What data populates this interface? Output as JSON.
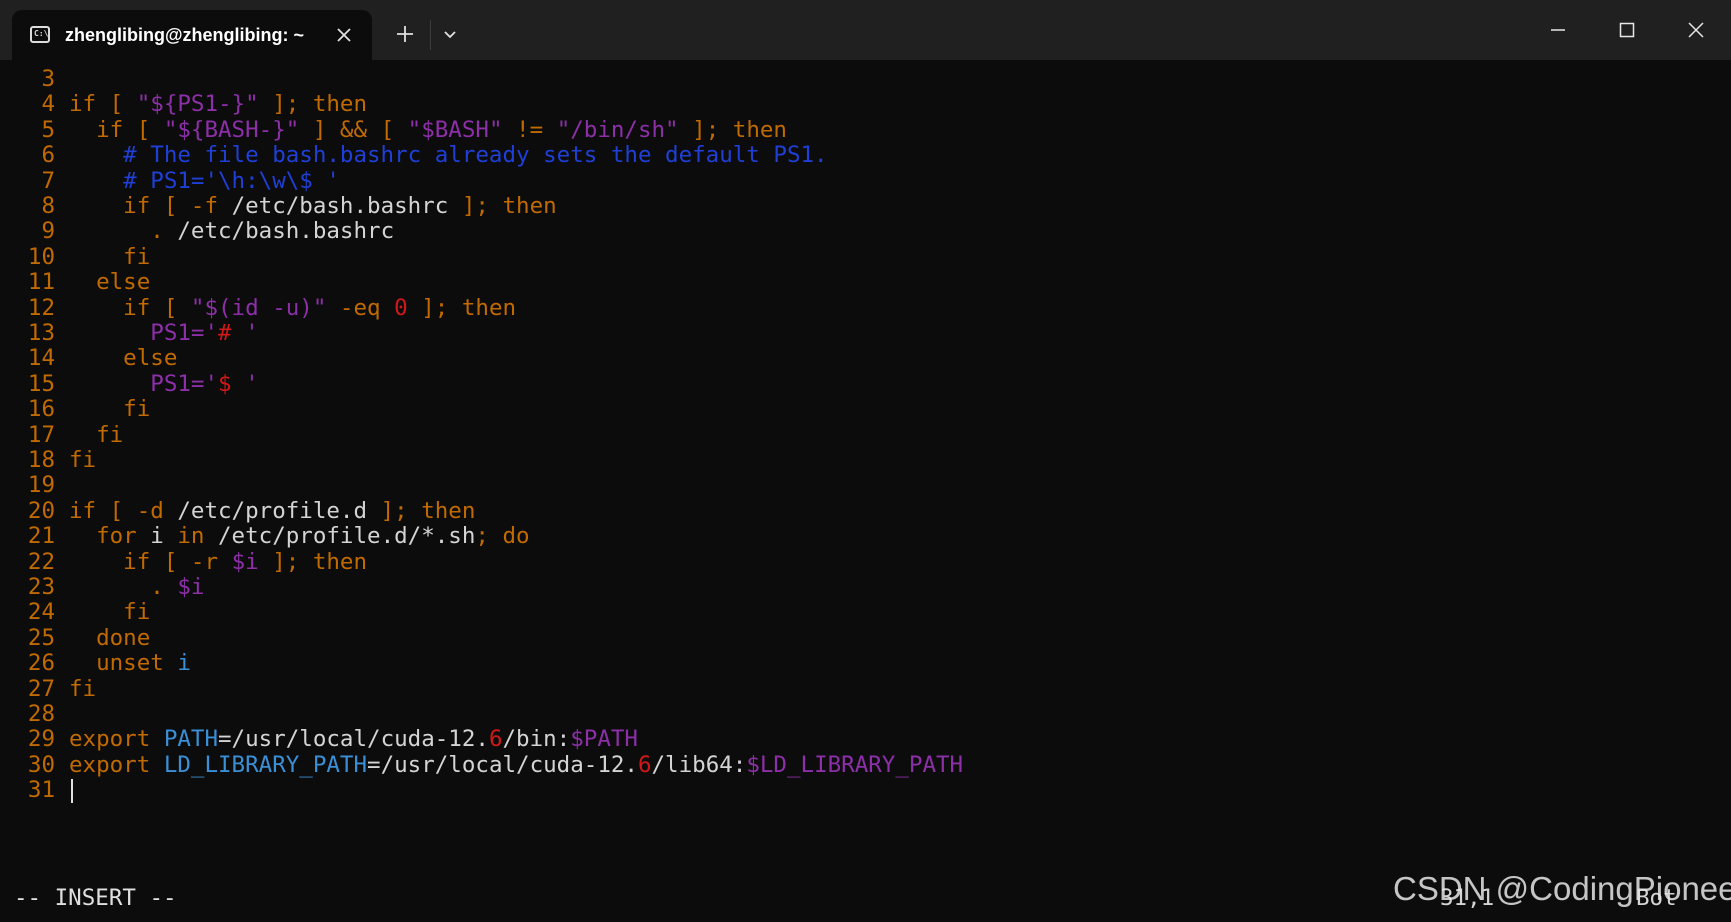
{
  "window": {
    "tab_title": "zhenglibing@zhenglibing: ~",
    "icons": {
      "terminal": "terminal-icon",
      "close_tab": "close-icon",
      "new_tab": "plus-icon",
      "dropdown": "chevron-down-icon",
      "minimize": "minimize-icon",
      "maximize": "maximize-icon",
      "close": "close-icon"
    }
  },
  "editor": {
    "lines": [
      {
        "n": "3",
        "segs": []
      },
      {
        "n": "4",
        "segs": [
          [
            "k",
            "if [ "
          ],
          [
            "str",
            "\"${PS1-}\""
          ],
          [
            "k",
            " ]; then"
          ]
        ]
      },
      {
        "n": "5",
        "segs": [
          [
            "k",
            "  if [ "
          ],
          [
            "str",
            "\"${BASH-}\""
          ],
          [
            "k",
            " ] && [ "
          ],
          [
            "str",
            "\"$BASH\""
          ],
          [
            "k",
            " != "
          ],
          [
            "str",
            "\"/bin/sh\""
          ],
          [
            "k",
            " ]; then"
          ]
        ]
      },
      {
        "n": "6",
        "segs": [
          [
            "cmt",
            "    # The file bash.bashrc already sets the default PS1."
          ]
        ]
      },
      {
        "n": "7",
        "segs": [
          [
            "cmt",
            "    # PS1='\\h:\\w\\$ '"
          ]
        ]
      },
      {
        "n": "8",
        "segs": [
          [
            "k",
            "    if [ -f "
          ],
          [
            "dflt",
            "/etc/bash.bashrc"
          ],
          [
            "k",
            " ]; then"
          ]
        ]
      },
      {
        "n": "9",
        "segs": [
          [
            "k",
            "      . "
          ],
          [
            "dflt",
            "/etc/bash.bashrc"
          ]
        ]
      },
      {
        "n": "10",
        "segs": [
          [
            "k",
            "    fi"
          ]
        ]
      },
      {
        "n": "11",
        "segs": [
          [
            "k",
            "  else"
          ]
        ]
      },
      {
        "n": "12",
        "segs": [
          [
            "k",
            "    if [ "
          ],
          [
            "str",
            "\"$(id -u)\""
          ],
          [
            "k",
            " -eq "
          ],
          [
            "num",
            "0"
          ],
          [
            "k",
            " ]; then"
          ]
        ]
      },
      {
        "n": "13",
        "segs": [
          [
            "str",
            "      PS1='"
          ],
          [
            "num",
            "#"
          ],
          [
            "str",
            " '"
          ]
        ]
      },
      {
        "n": "14",
        "segs": [
          [
            "k",
            "    else"
          ]
        ]
      },
      {
        "n": "15",
        "segs": [
          [
            "str",
            "      PS1='"
          ],
          [
            "num",
            "$"
          ],
          [
            "str",
            " '"
          ]
        ]
      },
      {
        "n": "16",
        "segs": [
          [
            "k",
            "    fi"
          ]
        ]
      },
      {
        "n": "17",
        "segs": [
          [
            "k",
            "  fi"
          ]
        ]
      },
      {
        "n": "18",
        "segs": [
          [
            "k",
            "fi"
          ]
        ]
      },
      {
        "n": "19",
        "segs": []
      },
      {
        "n": "20",
        "segs": [
          [
            "k",
            "if [ -d "
          ],
          [
            "dflt",
            "/etc/profile.d"
          ],
          [
            "k",
            " ]; then"
          ]
        ]
      },
      {
        "n": "21",
        "segs": [
          [
            "k",
            "  for "
          ],
          [
            "dflt",
            "i"
          ],
          [
            "k",
            " in "
          ],
          [
            "dflt",
            "/etc/profile.d/*.sh"
          ],
          [
            "k",
            "; do"
          ]
        ]
      },
      {
        "n": "22",
        "segs": [
          [
            "k",
            "    if [ -r "
          ],
          [
            "str",
            "$i"
          ],
          [
            "k",
            " ]; then"
          ]
        ]
      },
      {
        "n": "23",
        "segs": [
          [
            "k",
            "      . "
          ],
          [
            "str",
            "$i"
          ]
        ]
      },
      {
        "n": "24",
        "segs": [
          [
            "k",
            "    fi"
          ]
        ]
      },
      {
        "n": "25",
        "segs": [
          [
            "k",
            "  done"
          ]
        ]
      },
      {
        "n": "26",
        "segs": [
          [
            "k",
            "  unset "
          ],
          [
            "var",
            "i"
          ]
        ]
      },
      {
        "n": "27",
        "segs": [
          [
            "k",
            "fi"
          ]
        ]
      },
      {
        "n": "28",
        "segs": []
      },
      {
        "n": "29",
        "segs": [
          [
            "k",
            "export "
          ],
          [
            "var",
            "PATH"
          ],
          [
            "dflt",
            "=/usr/local/cuda-12."
          ],
          [
            "num",
            "6"
          ],
          [
            "dflt",
            "/bin:"
          ],
          [
            "str",
            "$PATH"
          ]
        ]
      },
      {
        "n": "30",
        "segs": [
          [
            "k",
            "export "
          ],
          [
            "var",
            "LD_LIBRARY_PATH"
          ],
          [
            "dflt",
            "=/usr/local/cuda-12."
          ],
          [
            "num",
            "6"
          ],
          [
            "dflt",
            "/lib64:"
          ],
          [
            "str",
            "$LD_LIBRARY_PATH"
          ]
        ]
      },
      {
        "n": "31",
        "segs": [],
        "cursor": true
      }
    ]
  },
  "statusbar": {
    "mode": "-- INSERT --",
    "position": "31,1",
    "scroll": "Bot"
  },
  "watermark": "CSDN @CodingPioneer",
  "colors": {
    "background": "#0c0c0c",
    "titlebar": "#202020",
    "keyword": "#c06a00",
    "string": "#8c2fa8",
    "comment": "#1f3fd6",
    "identifier": "#3a8fd6",
    "number": "#d01818"
  }
}
